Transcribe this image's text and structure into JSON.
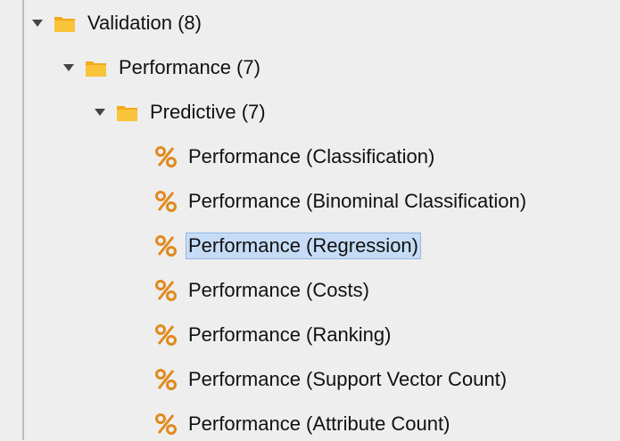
{
  "tree": {
    "root": {
      "label": "Validation (8)",
      "expanded": true
    },
    "child": {
      "label": "Performance (7)",
      "expanded": true
    },
    "grandchild": {
      "label": "Predictive (7)",
      "expanded": true
    },
    "operators": [
      {
        "label": "Performance (Classification)",
        "icon": "percent-icon",
        "selected": false
      },
      {
        "label": "Performance (Binominal Classification)",
        "icon": "percent-icon",
        "selected": false
      },
      {
        "label": "Performance (Regression)",
        "icon": "percent-icon",
        "selected": true
      },
      {
        "label": "Performance (Costs)",
        "icon": "percent-icon",
        "selected": false
      },
      {
        "label": "Performance (Ranking)",
        "icon": "percent-icon",
        "selected": false
      },
      {
        "label": "Performance (Support Vector Count)",
        "icon": "percent-icon",
        "selected": false
      },
      {
        "label": "Performance (Attribute Count)",
        "icon": "percent-icon",
        "selected": false
      }
    ]
  },
  "colors": {
    "background": "#eeeeee",
    "selection": "#c6dcf6",
    "folder": "#f7b531",
    "percent_icon": "#e08a1e"
  }
}
